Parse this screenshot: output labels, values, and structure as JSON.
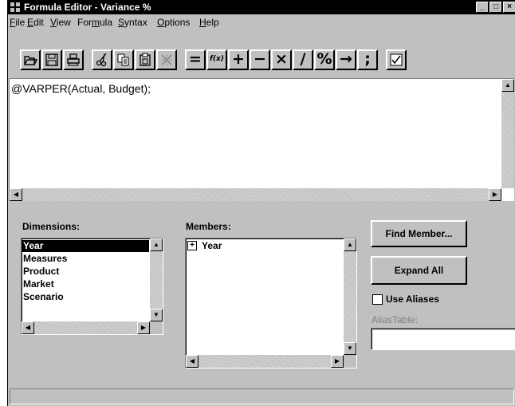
{
  "window": {
    "title": "Formula Editor - Variance %"
  },
  "title_buttons": {
    "minimize": "_",
    "maximize": "□",
    "close": "×"
  },
  "menu": [
    {
      "pre": "",
      "ul": "F",
      "post": "ile"
    },
    {
      "pre": "",
      "ul": "E",
      "post": "dit"
    },
    {
      "pre": "",
      "ul": "V",
      "post": "iew"
    },
    {
      "pre": "For",
      "ul": "m",
      "post": "ula"
    },
    {
      "pre": "",
      "ul": "S",
      "post": "yntax"
    },
    {
      "pre": "",
      "ul": "O",
      "post": "ptions"
    },
    {
      "pre": "",
      "ul": "H",
      "post": "elp"
    }
  ],
  "toolbar": {
    "icons": [
      "open-folder-icon",
      "save-disk-icon",
      "print-icon",
      "cut-scissors-icon",
      "copy-icon",
      "paste-clipboard-icon",
      "clear-icon"
    ],
    "operators": [
      "=",
      "f(x)",
      "+",
      "−",
      "×",
      "/",
      "%",
      "→",
      ";"
    ],
    "check_icon": "check-syntax-icon"
  },
  "editor": {
    "text": "@VARPER(Actual, Budget);"
  },
  "dimensions": {
    "label": "Dimensions:",
    "items": [
      "Year",
      "Measures",
      "Product",
      "Market",
      "Scenario"
    ],
    "selected": "Year"
  },
  "members": {
    "label": "Members:",
    "items": [
      "Year"
    ],
    "expand_symbol": "+"
  },
  "buttons": {
    "find_member": "Find Member...",
    "expand_all": "Expand All"
  },
  "use_aliases": {
    "label": "Use Aliases",
    "checked": false
  },
  "alias_table": {
    "label": "AliasTable:",
    "value": ""
  },
  "status": {
    "text": ""
  }
}
